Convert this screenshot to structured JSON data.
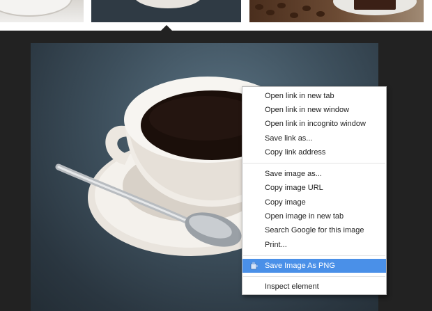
{
  "context_menu": {
    "items_link": [
      "Open link in new tab",
      "Open link in new window",
      "Open link in incognito window",
      "Save link as...",
      "Copy link address"
    ],
    "items_image": [
      "Save image as...",
      "Copy image URL",
      "Copy image",
      "Open image in new tab",
      "Search Google for this image",
      "Print..."
    ],
    "extension_item": {
      "label": "Save Image As PNG",
      "icon": "extension-puzzle-icon",
      "highlighted": true
    },
    "inspect_item": "Inspect element",
    "highlight_color": "#4a90e8"
  }
}
